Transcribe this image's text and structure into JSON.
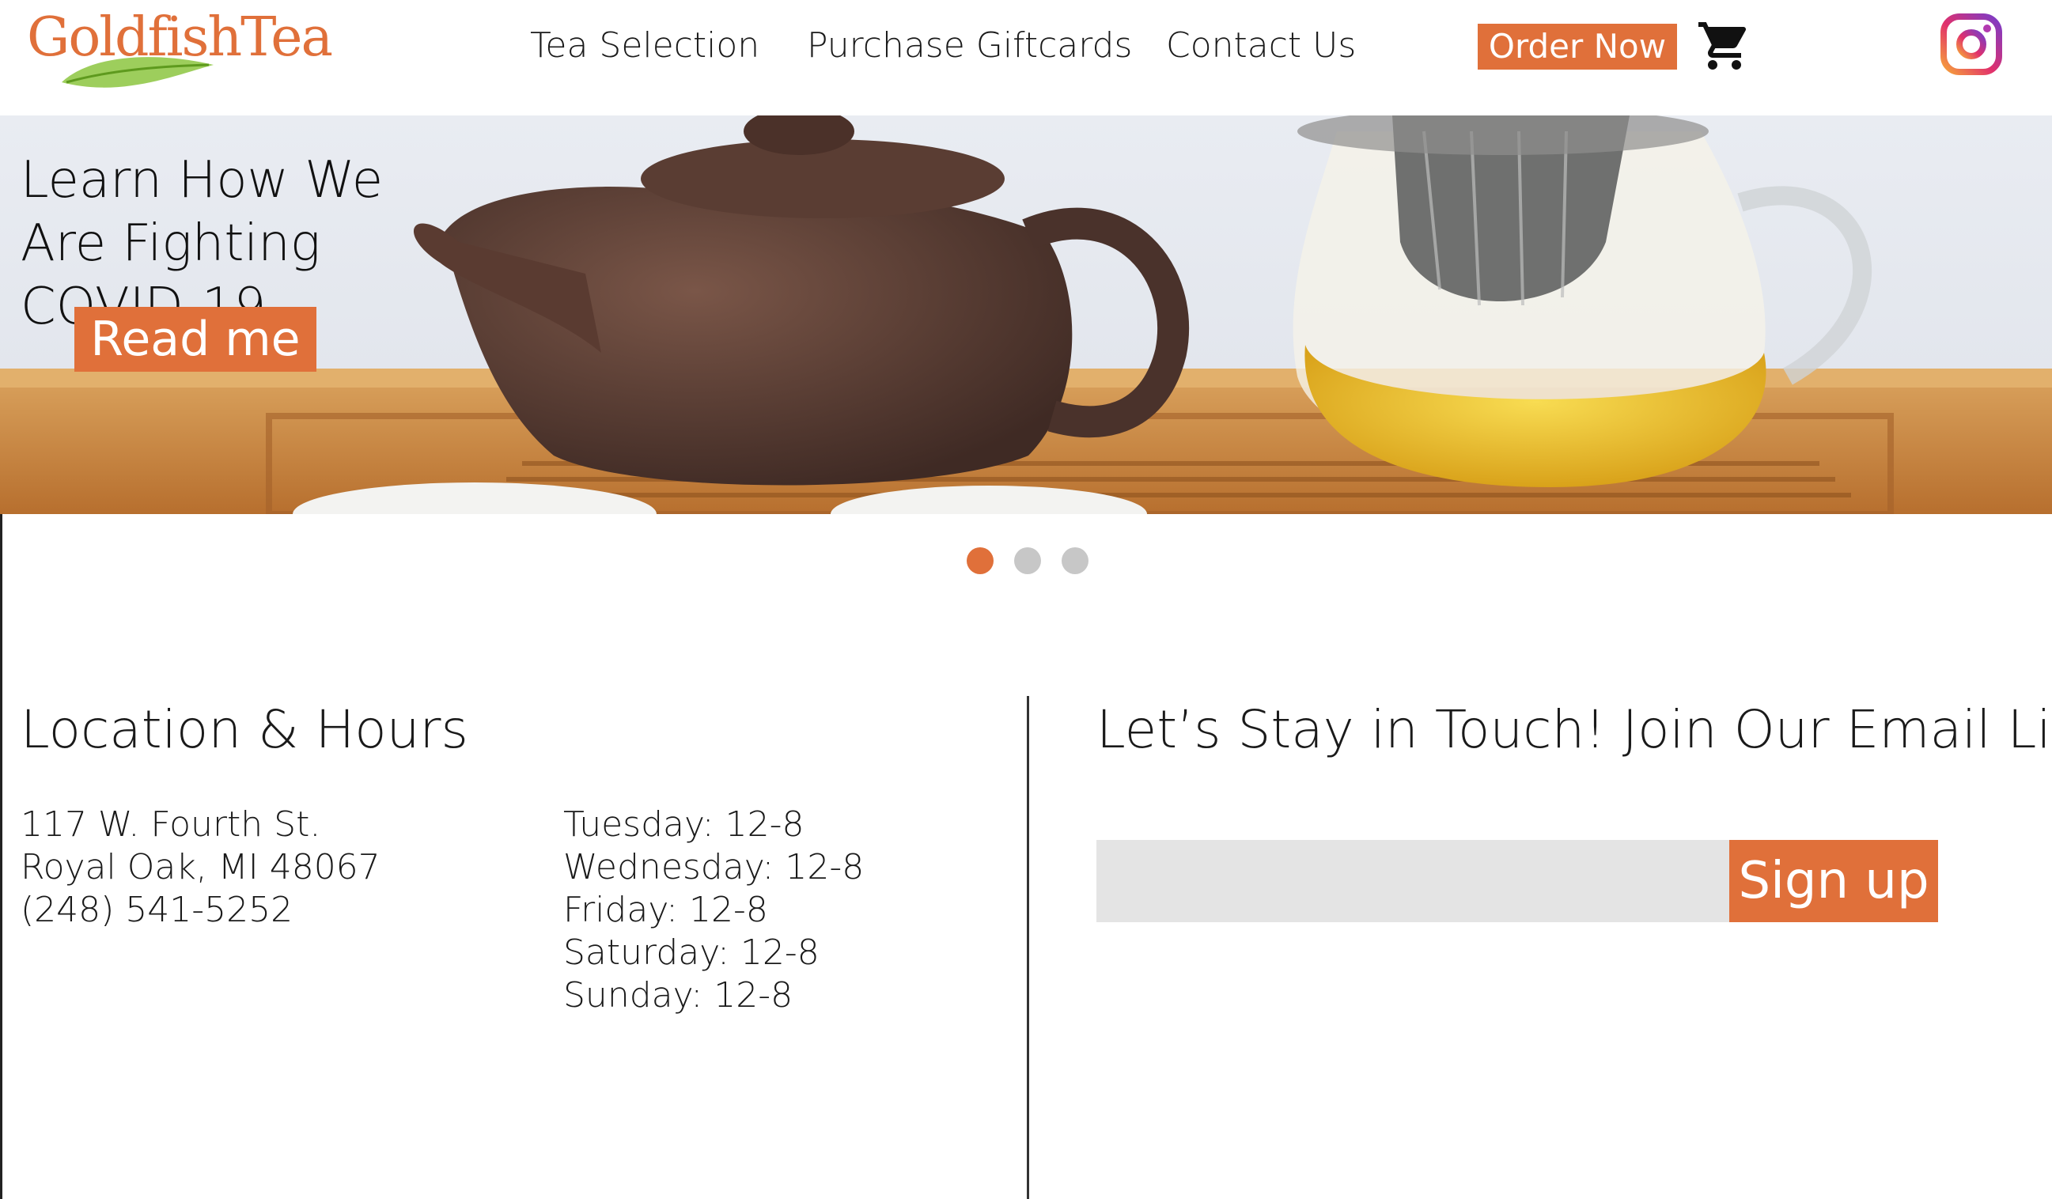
{
  "brand": {
    "logo_text": "GoldfishTea",
    "accent_color": "#e0703a",
    "leaf_color": "#8cc63f"
  },
  "nav": {
    "items": [
      {
        "label": "Tea Selection"
      },
      {
        "label": "Purchase Giftcards"
      },
      {
        "label": "Contact Us"
      }
    ],
    "order_label": "Order Now",
    "cart_icon": "shopping-cart-icon",
    "social_icon": "instagram-icon"
  },
  "hero": {
    "title": "Learn How We Are Fighting COVID-19",
    "button_label": "Read me",
    "slide_count": 3,
    "active_slide": 1
  },
  "location": {
    "title": "Location & Hours",
    "address": [
      "117 W. Fourth St.",
      "Royal Oak, MI 48067",
      "(248) 541-5252"
    ],
    "hours": [
      "Tuesday: 12-8",
      "Wednesday: 12-8",
      "Friday: 12-8",
      "Saturday: 12-8",
      "Sunday: 12-8"
    ]
  },
  "email": {
    "title": "Let’s Stay in Touch! Join Our Email List!",
    "input_value": "",
    "input_placeholder": "",
    "button_label": "Sign up"
  }
}
